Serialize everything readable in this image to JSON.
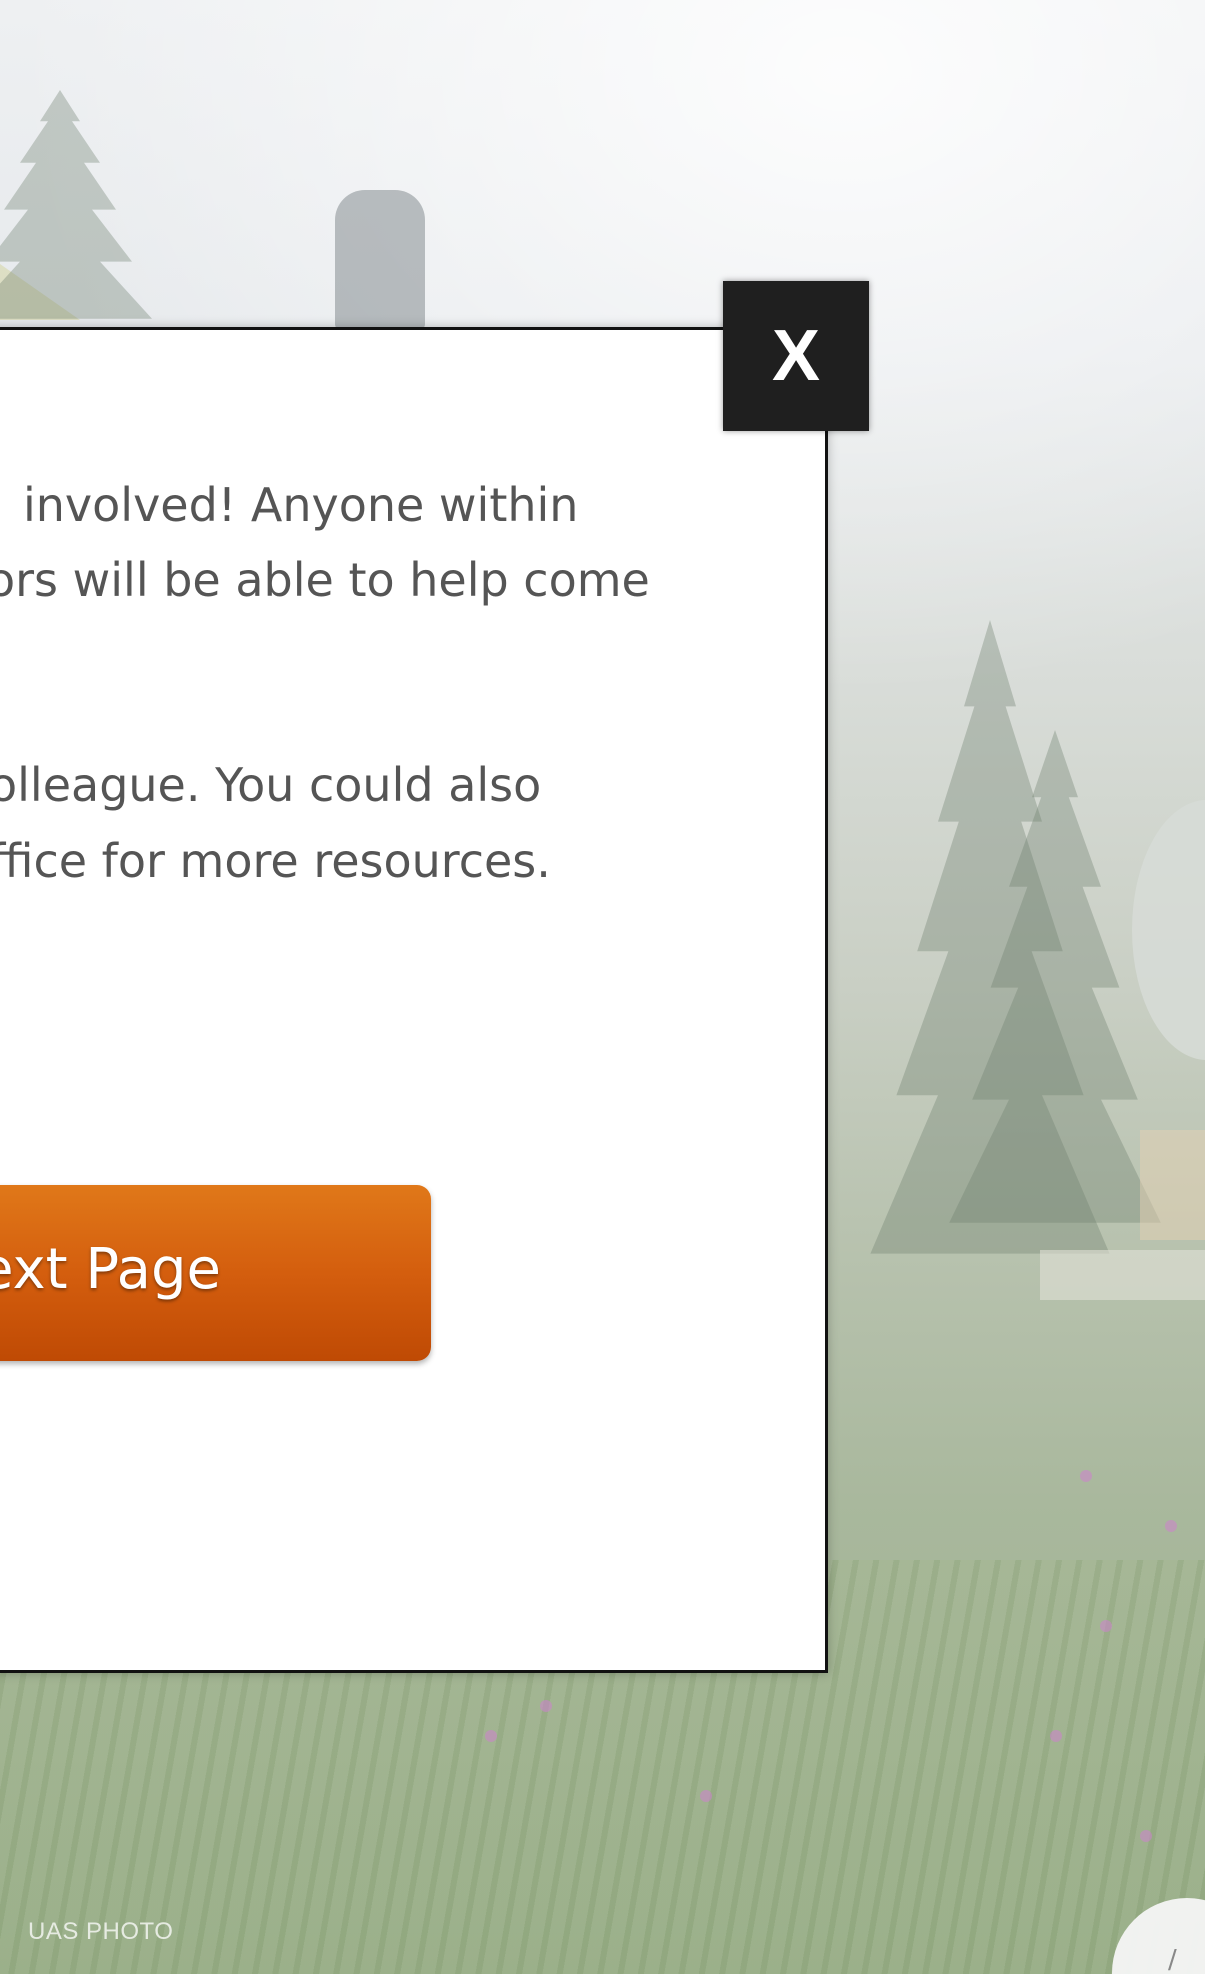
{
  "modal": {
    "paragraph1_line1": "involved! Anyone within",
    "paragraph1_line2": "ors will be able to help come",
    "paragraph2_line1": "olleague. You could also",
    "paragraph2_line2": "ffice for more resources.",
    "next_button_label": "ext Page",
    "close_label": "X"
  },
  "background": {
    "photo_credit": "UAS PHOTO"
  },
  "colors": {
    "button_orange": "#d45e0e",
    "close_dark": "#1f1f1f",
    "text_gray": "#555555"
  },
  "icons": {
    "close": "close-icon"
  }
}
